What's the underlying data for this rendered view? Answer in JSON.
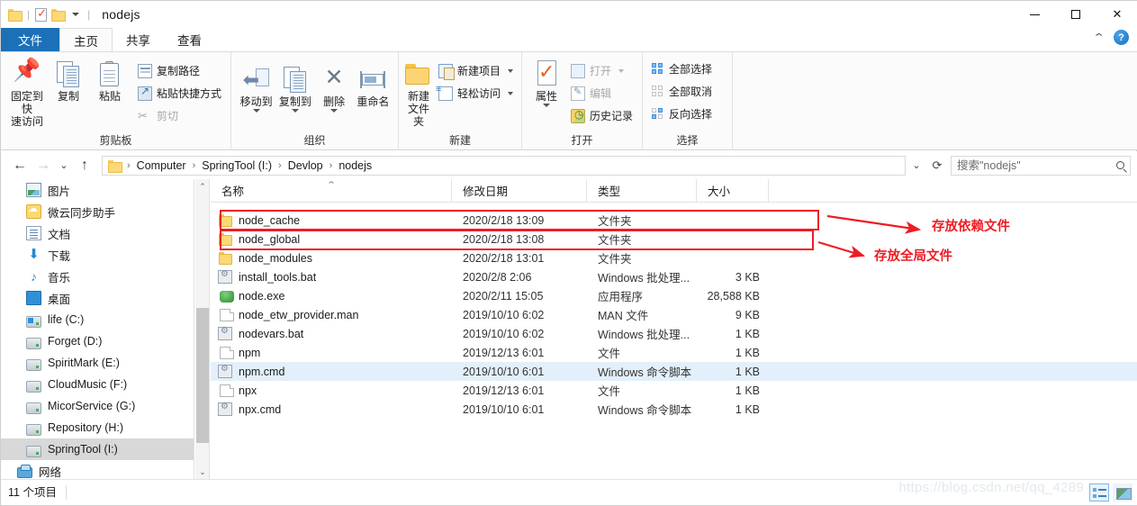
{
  "titlebar": {
    "title": "nodejs",
    "quick_access": [
      "folder-icon",
      "properties-icon",
      "new-folder-icon",
      "customize-caret-icon"
    ],
    "controls": {
      "minimize": "—",
      "maximize": "□",
      "close": "✕"
    }
  },
  "tabs": [
    {
      "label": "文件",
      "name": "tab-file",
      "style": "blue"
    },
    {
      "label": "主页",
      "name": "tab-home",
      "style": "active"
    },
    {
      "label": "共享",
      "name": "tab-share",
      "style": "normal"
    },
    {
      "label": "查看",
      "name": "tab-view",
      "style": "normal"
    }
  ],
  "ribbon": {
    "groups": [
      {
        "title": "剪贴板",
        "big": [
          {
            "label_line1": "固定到快",
            "label_line2": "速访问",
            "icon": "pin-icon"
          },
          {
            "label_line1": "复制",
            "label_line2": "",
            "icon": "copy-icon"
          },
          {
            "label_line1": "粘贴",
            "label_line2": "",
            "icon": "paste-icon"
          }
        ],
        "small": [
          {
            "label": "复制路径",
            "icon": "copy-path-icon",
            "dim": false
          },
          {
            "label": "粘贴快捷方式",
            "icon": "paste-shortcut-icon",
            "dim": false
          },
          {
            "label": "剪切",
            "icon": "scissors-icon",
            "dim": true
          }
        ]
      },
      {
        "title": "组织",
        "big": [
          {
            "label_line1": "移动到",
            "label_line2": "",
            "icon": "move-to-icon",
            "caret": true
          },
          {
            "label_line1": "复制到",
            "label_line2": "",
            "icon": "copy-to-icon",
            "caret": true
          },
          {
            "label_line1": "删除",
            "label_line2": "",
            "icon": "delete-icon",
            "caret": true
          },
          {
            "label_line1": "重命名",
            "label_line2": "",
            "icon": "rename-icon"
          }
        ]
      },
      {
        "title": "新建",
        "big": [
          {
            "label_line1": "新建",
            "label_line2": "文件夹",
            "icon": "new-folder-icon"
          }
        ],
        "small": [
          {
            "label": "新建项目",
            "icon": "new-item-icon",
            "caret": true
          },
          {
            "label": "轻松访问",
            "icon": "easy-access-icon",
            "caret": true
          }
        ]
      },
      {
        "title": "打开",
        "big": [
          {
            "label_line1": "属性",
            "label_line2": "",
            "icon": "properties-icon",
            "caret": true
          }
        ],
        "small": [
          {
            "label": "打开",
            "icon": "open-icon",
            "caret": true,
            "dim": true
          },
          {
            "label": "编辑",
            "icon": "edit-icon",
            "dim": true
          },
          {
            "label": "历史记录",
            "icon": "history-icon"
          }
        ]
      },
      {
        "title": "选择",
        "small": [
          {
            "label": "全部选择",
            "icon": "select-all-icon"
          },
          {
            "label": "全部取消",
            "icon": "select-none-icon"
          },
          {
            "label": "反向选择",
            "icon": "invert-selection-icon"
          }
        ]
      }
    ],
    "collapse_icon": "chevron-up-icon",
    "help_label": "?"
  },
  "addressbar": {
    "back_icon": "back-arrow-icon",
    "forward_icon": "forward-arrow-icon",
    "recent_icon": "chevron-down-icon",
    "up_icon": "up-arrow-icon",
    "breadcrumbs": [
      "Computer",
      "SpringTool (I:)",
      "Devlop",
      "nodejs"
    ],
    "separator": "›",
    "dropdown_icon": "chevron-down-icon",
    "refresh_icon": "refresh-icon",
    "search_placeholder": "搜索\"nodejs\"",
    "search_value": "",
    "search_icon": "search-icon"
  },
  "sidebar": {
    "items": [
      {
        "label": "图片",
        "icon": "pictures-icon",
        "selected": false
      },
      {
        "label": "微云同步助手",
        "icon": "weiyun-sync-icon",
        "selected": false
      },
      {
        "label": "文档",
        "icon": "documents-icon",
        "selected": false
      },
      {
        "label": "下载",
        "icon": "downloads-icon",
        "selected": false
      },
      {
        "label": "音乐",
        "icon": "music-icon",
        "selected": false
      },
      {
        "label": "桌面",
        "icon": "desktop-icon",
        "selected": false
      },
      {
        "label": "life (C:)",
        "icon": "system-drive-icon",
        "selected": false
      },
      {
        "label": "Forget (D:)",
        "icon": "drive-icon",
        "selected": false
      },
      {
        "label": "SpiritMark (E:)",
        "icon": "drive-icon",
        "selected": false
      },
      {
        "label": "CloudMusic (F:)",
        "icon": "drive-icon",
        "selected": false
      },
      {
        "label": "MicorService (G:)",
        "icon": "drive-icon",
        "selected": false
      },
      {
        "label": "Repository (H:)",
        "icon": "drive-icon",
        "selected": false
      },
      {
        "label": "SpringTool (I:)",
        "icon": "drive-icon",
        "selected": true
      }
    ],
    "root": {
      "label": "网络",
      "icon": "network-icon"
    },
    "scrollbar": {
      "up_icon": "scroll-up-icon",
      "down_icon": "scroll-down-icon"
    }
  },
  "filelist": {
    "columns": [
      {
        "label": "名称",
        "sorted": true,
        "sort_icon": "sort-asc-icon"
      },
      {
        "label": "修改日期",
        "sorted": false
      },
      {
        "label": "类型",
        "sorted": false
      },
      {
        "label": "大小",
        "sorted": false
      }
    ],
    "rows": [
      {
        "name": "node_cache",
        "date": "2020/2/18 13:09",
        "type": "文件夹",
        "size": "",
        "icon": "folder-icon",
        "state": "annotated"
      },
      {
        "name": "node_global",
        "date": "2020/2/18 13:08",
        "type": "文件夹",
        "size": "",
        "icon": "folder-icon",
        "state": "annotated"
      },
      {
        "name": "node_modules",
        "date": "2020/2/18 13:01",
        "type": "文件夹",
        "size": "",
        "icon": "folder-icon",
        "state": "normal"
      },
      {
        "name": "install_tools.bat",
        "date": "2020/2/8 2:06",
        "type": "Windows 批处理...",
        "size": "3 KB",
        "icon": "bat-icon",
        "state": "normal"
      },
      {
        "name": "node.exe",
        "date": "2020/2/11 15:05",
        "type": "应用程序",
        "size": "28,588 KB",
        "icon": "exe-icon",
        "state": "normal"
      },
      {
        "name": "node_etw_provider.man",
        "date": "2019/10/10 6:02",
        "type": "MAN 文件",
        "size": "9 KB",
        "icon": "file-icon",
        "state": "normal"
      },
      {
        "name": "nodevars.bat",
        "date": "2019/10/10 6:02",
        "type": "Windows 批处理...",
        "size": "1 KB",
        "icon": "bat-icon",
        "state": "normal"
      },
      {
        "name": "npm",
        "date": "2019/12/13 6:01",
        "type": "文件",
        "size": "1 KB",
        "icon": "file-icon",
        "state": "normal"
      },
      {
        "name": "npm.cmd",
        "date": "2019/10/10 6:01",
        "type": "Windows 命令脚本",
        "size": "1 KB",
        "icon": "bat-icon",
        "state": "hovered"
      },
      {
        "name": "npx",
        "date": "2019/12/13 6:01",
        "type": "文件",
        "size": "1 KB",
        "icon": "file-icon",
        "state": "normal"
      },
      {
        "name": "npx.cmd",
        "date": "2019/10/10 6:01",
        "type": "Windows 命令脚本",
        "size": "1 KB",
        "icon": "bat-icon",
        "state": "normal"
      }
    ]
  },
  "annotations": {
    "color": "#ee1c24",
    "labels": [
      {
        "text": "存放依赖文件",
        "target_row": "node_cache"
      },
      {
        "text": "存放全局文件",
        "target_row": "node_global"
      }
    ]
  },
  "statusbar": {
    "item_count": "11 个项目",
    "watermark": "https://blog.csdn.net/qq_4289",
    "view_buttons": [
      {
        "icon": "details-view-icon",
        "active": true
      },
      {
        "icon": "thumbnails-view-icon",
        "active": false
      }
    ]
  }
}
